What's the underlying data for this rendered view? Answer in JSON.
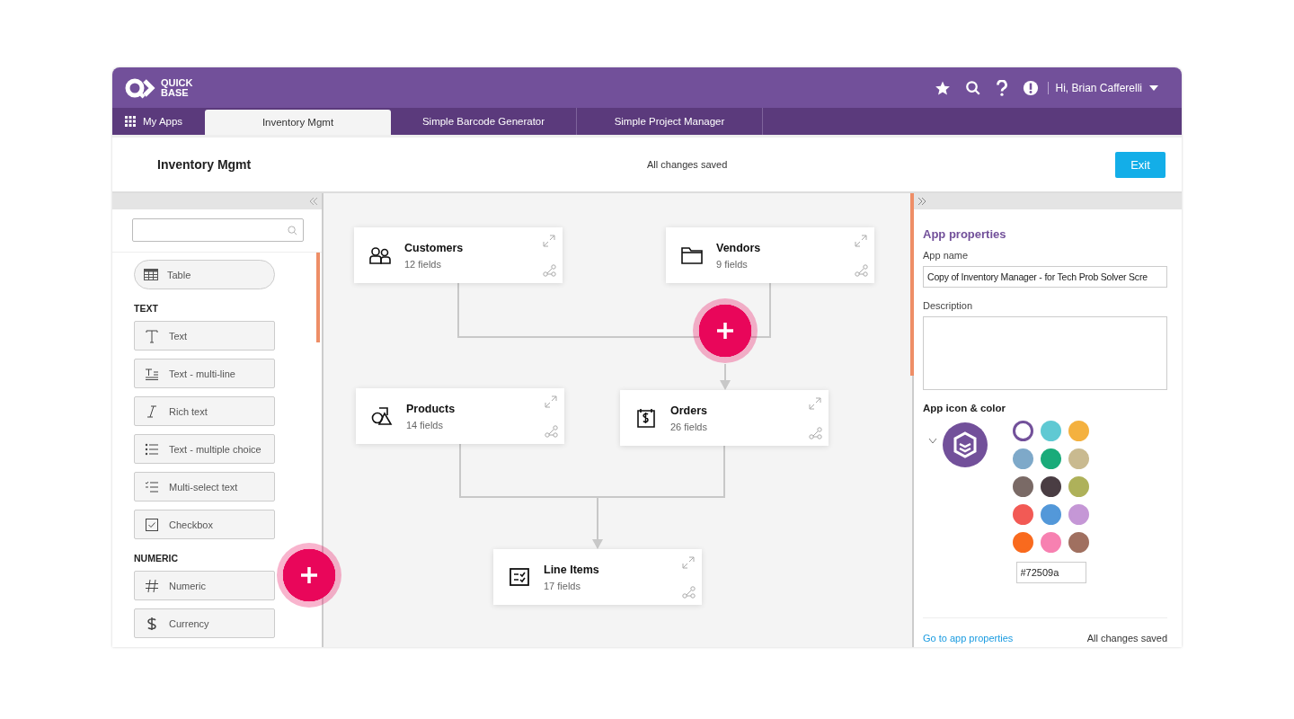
{
  "header": {
    "logo": [
      "QUICK",
      "BASE"
    ],
    "user": "Hi, Brian Cafferelli"
  },
  "tabs": [
    {
      "label": "My Apps",
      "kind": "apps",
      "selected": false
    },
    {
      "label": "Inventory Mgmt",
      "kind": "app",
      "selected": true
    },
    {
      "label": "Simple Barcode Generator",
      "kind": "app",
      "selected": false
    },
    {
      "label": "Simple Project Manager",
      "kind": "app",
      "selected": false
    }
  ],
  "titlebar": {
    "title": "Inventory Mgmt",
    "status": "All changes saved",
    "exit": "Exit"
  },
  "palette": {
    "table": "Table",
    "sections": [
      {
        "heading": "TEXT",
        "items": [
          {
            "label": "Text",
            "kind": "text"
          },
          {
            "label": "Text - multi-line",
            "kind": "multiline"
          },
          {
            "label": "Rich text",
            "kind": "rich"
          },
          {
            "label": "Text - multiple choice",
            "kind": "list"
          },
          {
            "label": "Multi-select text",
            "kind": "checklist"
          },
          {
            "label": "Checkbox",
            "kind": "checkbox"
          }
        ]
      },
      {
        "heading": "NUMERIC",
        "items": [
          {
            "label": "Numeric",
            "kind": "numeric"
          },
          {
            "label": "Currency",
            "kind": "currency"
          }
        ]
      }
    ]
  },
  "tables": [
    {
      "name": "Customers",
      "fields": "12 fields",
      "kind": "people"
    },
    {
      "name": "Vendors",
      "fields": "9 fields",
      "kind": "folder"
    },
    {
      "name": "Products",
      "fields": "14 fields",
      "kind": "shapes"
    },
    {
      "name": "Orders",
      "fields": "26 fields",
      "kind": "receipt"
    },
    {
      "name": "Line Items",
      "fields": "17 fields",
      "kind": "checklist"
    }
  ],
  "properties": {
    "title": "App properties",
    "name_label": "App name",
    "name_value": "Copy of Inventory Manager - for Tech Prob Solver Scre",
    "description_label": "Description",
    "icon_label": "App icon & color",
    "swatches": [
      {
        "color": "#ffffff",
        "selected": true
      },
      {
        "color": "#5fc9d3",
        "selected": false
      },
      {
        "color": "#f4b13f",
        "selected": false
      },
      {
        "color": "#7ea9c9",
        "selected": false
      },
      {
        "color": "#1aab7a",
        "selected": false
      },
      {
        "color": "#c9ba90",
        "selected": false
      },
      {
        "color": "#7a6a66",
        "selected": false
      },
      {
        "color": "#4a3d43",
        "selected": false
      },
      {
        "color": "#aeb15a",
        "selected": false
      },
      {
        "color": "#f25a55",
        "selected": false
      },
      {
        "color": "#5398d9",
        "selected": false
      },
      {
        "color": "#c597d6",
        "selected": false
      },
      {
        "color": "#f96a1e",
        "selected": false
      },
      {
        "color": "#f781b1",
        "selected": false
      },
      {
        "color": "#a07060",
        "selected": false
      }
    ],
    "hex": "#72509a",
    "link": "Go to app properties",
    "status": "All changes saved"
  }
}
